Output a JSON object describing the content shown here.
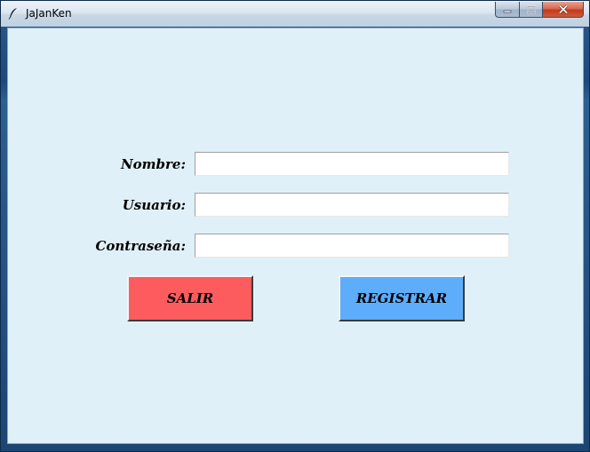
{
  "window": {
    "title": "JaJanKen",
    "icon": "feather-icon",
    "controls": {
      "minimize": "minimize-icon",
      "maximize": "maximize-icon",
      "close": "close-icon"
    }
  },
  "form": {
    "fields": [
      {
        "label": "Nombre:",
        "value": "",
        "placeholder": ""
      },
      {
        "label": "Usuario:",
        "value": "",
        "placeholder": ""
      },
      {
        "label": "Contraseña:",
        "value": "",
        "placeholder": ""
      }
    ],
    "buttons": {
      "exit_label": "SALIR",
      "register_label": "REGISTRAR"
    }
  },
  "colors": {
    "background": "#dff0f8",
    "exit_button": "#fd5c5e",
    "register_button": "#5eadfb"
  }
}
